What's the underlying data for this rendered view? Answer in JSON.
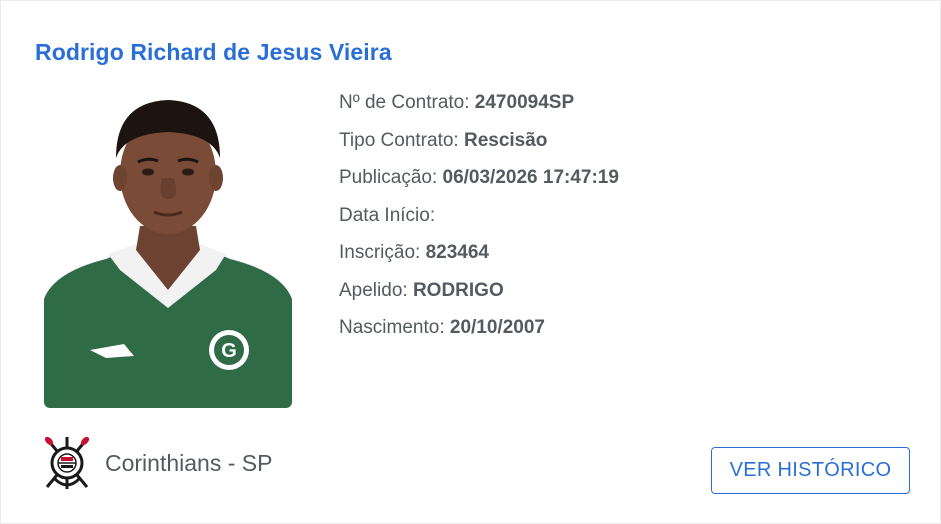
{
  "player": {
    "name": "Rodrigo Richard de Jesus Vieira",
    "photo_icon": "player-photo"
  },
  "details": {
    "contrato": {
      "label": "Nº de Contrato:",
      "value": "2470094SP"
    },
    "tipo": {
      "label": "Tipo Contrato:",
      "value": "Rescisão"
    },
    "publicacao": {
      "label": "Publicação:",
      "value": "06/03/2026 17:47:19"
    },
    "data_inicio": {
      "label": "Data Início:",
      "value": ""
    },
    "inscricao": {
      "label": "Inscrição:",
      "value": "823464"
    },
    "apelido": {
      "label": "Apelido:",
      "value": "RODRIGO"
    },
    "nascimento": {
      "label": "Nascimento:",
      "value": "20/10/2007"
    }
  },
  "club": {
    "name": "Corinthians - SP",
    "logo_icon": "corinthians-crest-icon"
  },
  "actions": {
    "history_label": "VER HISTÓRICO"
  },
  "colors": {
    "accent": "#2a6fd6",
    "text": "#555a60",
    "jersey": "#2f6b47"
  }
}
